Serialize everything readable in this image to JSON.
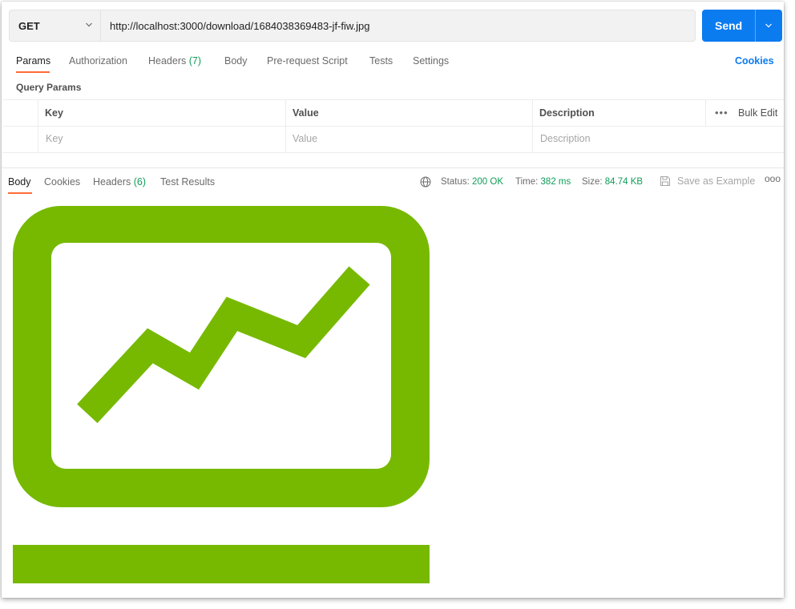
{
  "request": {
    "method": "GET",
    "url": "http://localhost:3000/download/1684038369483-jf-fiw.jpg",
    "send_label": "Send"
  },
  "request_tabs": {
    "params": "Params",
    "authorization": "Authorization",
    "headers": "Headers",
    "headers_count": "(7)",
    "body": "Body",
    "pre_request_script": "Pre-request Script",
    "tests": "Tests",
    "settings": "Settings",
    "cookies": "Cookies"
  },
  "query_params": {
    "section_title": "Query Params",
    "columns": {
      "key": "Key",
      "value": "Value",
      "description": "Description"
    },
    "more": "•••",
    "bulk_edit": "Bulk Edit",
    "placeholders": {
      "key": "Key",
      "value": "Value",
      "description": "Description"
    }
  },
  "response_tabs": {
    "body": "Body",
    "cookies": "Cookies",
    "headers": "Headers",
    "headers_count": "(6)",
    "test_results": "Test Results"
  },
  "response_meta": {
    "status_label": "Status:",
    "status_value": "200 OK",
    "time_label": "Time:",
    "time_value": "382 ms",
    "size_label": "Size:",
    "size_value": "84.74 KB",
    "save_as_example": "Save as Example",
    "more": "ooo"
  },
  "colors": {
    "accent": "#0b7bf0",
    "tab_underline": "#ff6c37",
    "status_green": "#0f9d58",
    "preview_green": "#76b900"
  },
  "icons": {
    "method_dropdown": "chevron-down-icon",
    "send_dropdown": "chevron-down-icon",
    "network": "globe-icon",
    "save": "floppy-disk-icon",
    "preview_image": "trending-chart-monitor-icon"
  }
}
